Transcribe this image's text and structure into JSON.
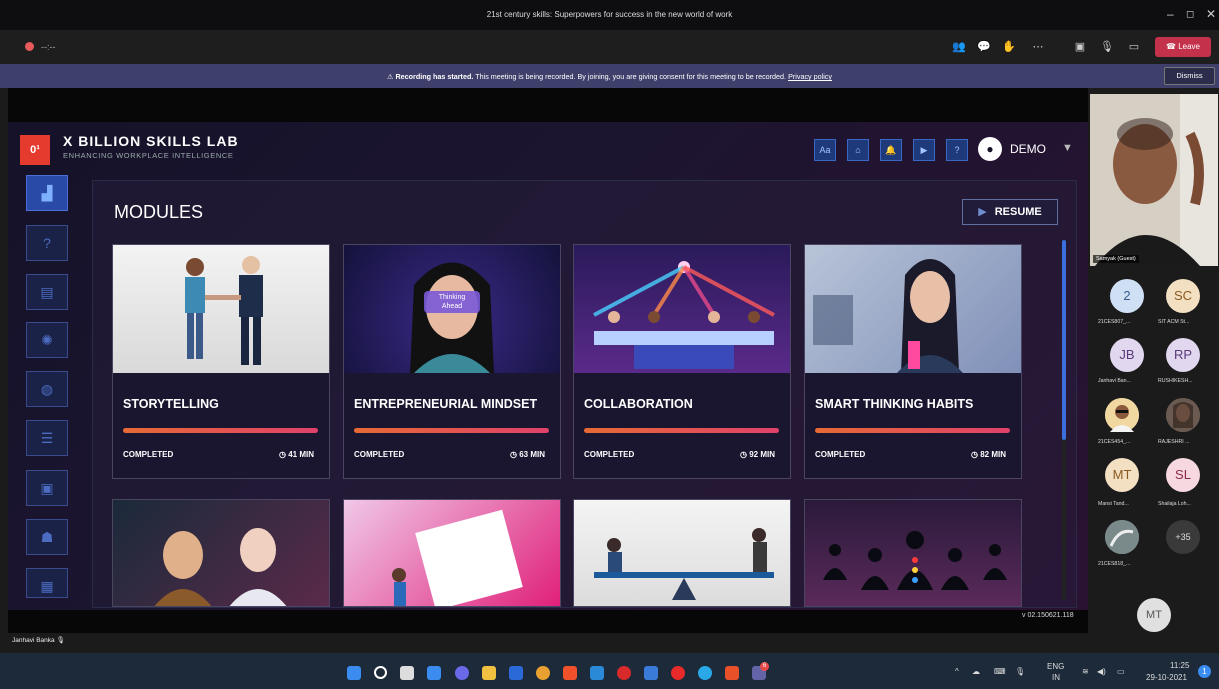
{
  "window": {
    "title": "21st century skills: Superpowers for success in the new world of work"
  },
  "toolbar": {
    "timer": "--:--",
    "leave": "Leave"
  },
  "banner": {
    "strong": "Recording has started.",
    "text": "This meeting is being recorded. By joining, you are giving consent for this meeting to be recorded.",
    "link": "Privacy policy",
    "dismiss": "Dismiss"
  },
  "app": {
    "logo": "0¹",
    "brand": "X BILLION SKILLS LAB",
    "tagline": "ENHANCING WORKPLACE INTELLIGENCE",
    "user": "DEMO",
    "header_btn_font": "Aa",
    "section_title": "MODULES",
    "resume": "RESUME",
    "version": "v 02.150621.118"
  },
  "modules": [
    {
      "name": "STORYTELLING",
      "status": "COMPLETED",
      "duration": "41 MIN",
      "progress": 1.0
    },
    {
      "name": "ENTREPRENEURIAL MINDSET",
      "status": "COMPLETED",
      "duration": "63 MIN",
      "progress": 1.0
    },
    {
      "name": "COLLABORATION",
      "status": "COMPLETED",
      "duration": "92 MIN",
      "progress": 1.0
    },
    {
      "name": "SMART THINKING HABITS",
      "status": "COMPLETED",
      "duration": "82 MIN",
      "progress": 1.0
    }
  ],
  "card_art": {
    "thinking": "Thinking Ahead"
  },
  "presenter": {
    "label": "Samyak (Guest)",
    "bottom_name": "Janhavi Banka"
  },
  "participants": [
    {
      "initials": "2",
      "label": "21CES807_...",
      "color": "#cfe0f5",
      "text_color": "#3a5a8a"
    },
    {
      "initials": "SC",
      "label": "SIT ACM St...",
      "color": "#f3dfc1",
      "text_color": "#8a5a20"
    },
    {
      "initials": "JB",
      "label": "Janhavi Ban...",
      "color": "#e1d8ef",
      "text_color": "#5a3a7a"
    },
    {
      "initials": "RP",
      "label": "RUSHIKESH...",
      "color": "#e1d8ef",
      "text_color": "#5a3a7a"
    },
    {
      "initials": "",
      "label": "21CES454_...",
      "color": "#c8b89a",
      "text_color": "#333"
    },
    {
      "initials": "",
      "label": "RAJESHRI ...",
      "color": "#6a5a52",
      "text_color": "#333"
    },
    {
      "initials": "MT",
      "label": "Mansi Tand...",
      "color": "#f3dfc1",
      "text_color": "#8a5a20"
    },
    {
      "initials": "SL",
      "label": "Shailaja Loh...",
      "color": "#f7d7e0",
      "text_color": "#8a2a4a"
    },
    {
      "initials": "",
      "label": "21CES818_...",
      "color": "#8a9a9a",
      "text_color": "#333"
    },
    {
      "initials": "+35",
      "label": "",
      "color": "#3a3a3a",
      "text_color": "#ddd"
    }
  ],
  "self_avatar": "MT",
  "taskbar": {
    "lang": "ENG",
    "region": "IN",
    "time": "11:25",
    "date": "29-10-2021",
    "notif": "1",
    "teams_badge": "6"
  }
}
